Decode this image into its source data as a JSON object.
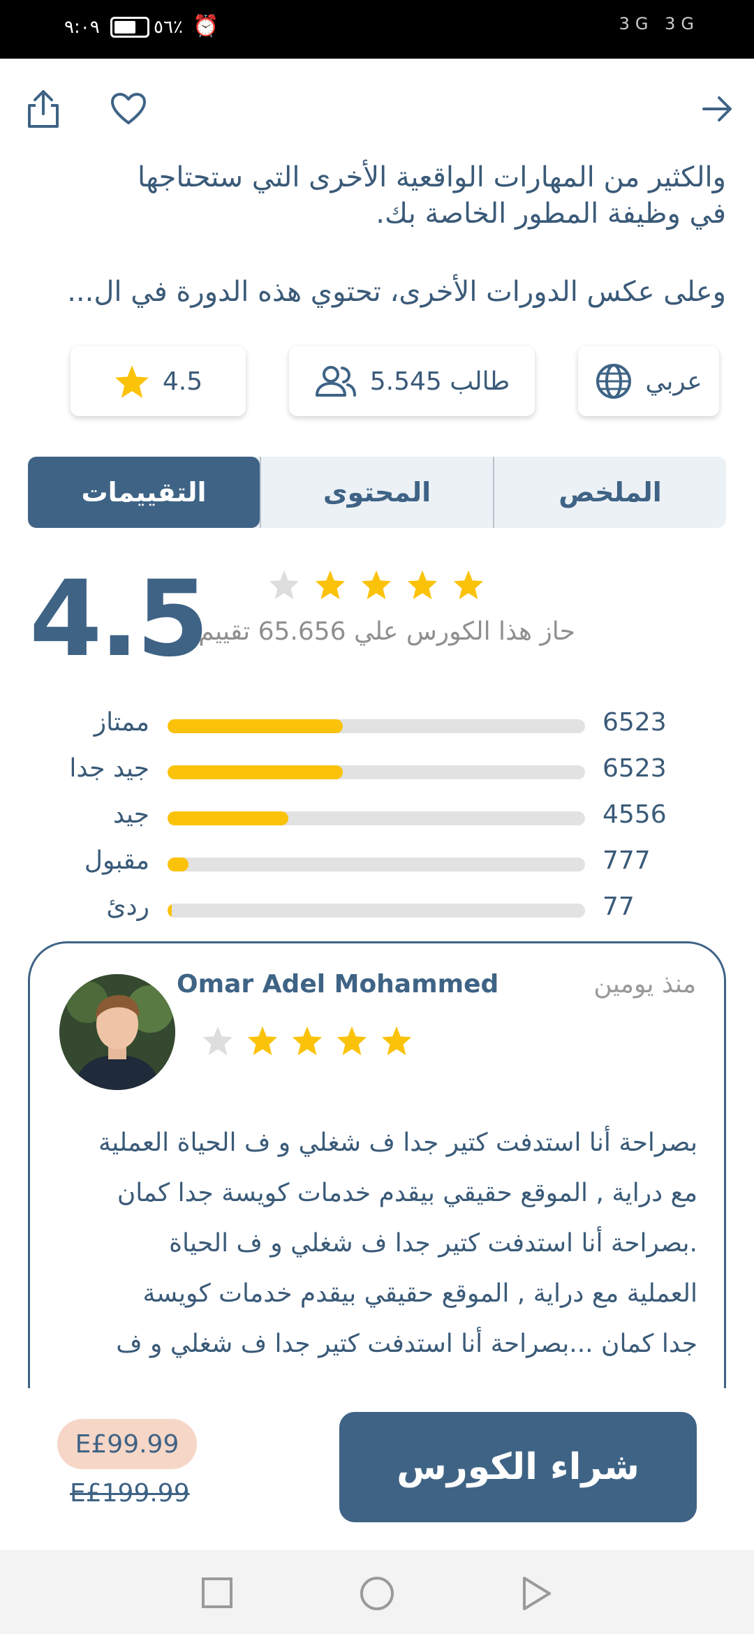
{
  "status_bar": {
    "time": "٩:٠٩",
    "battery_pct": "٥٦٪",
    "network": "3G 3G"
  },
  "course": {
    "description_lines": [
      "والكثير من المهارات الواقعية الأخرى التي ستحتاجها",
      "في وظيفة المطور الخاصة بك."
    ],
    "description_more": "وعلى عكس الدورات الأخرى، تحتوي هذه الدورة في ال..."
  },
  "chips": {
    "language": "عربي",
    "students": "5.545 طالب",
    "rating": "4.5"
  },
  "tabs": [
    {
      "label": "الملخص",
      "active": false
    },
    {
      "label": "المحتوى",
      "active": false
    },
    {
      "label": "التقييمات",
      "active": true
    }
  ],
  "ratings": {
    "average": "4.5",
    "average_value": 4.5,
    "summary": "حاز هذا الكورس علي 65.656 تقييم",
    "breakdown": [
      {
        "label": "ممتاز",
        "count": "6523",
        "fraction": 0.42
      },
      {
        "label": "جيد جدا",
        "count": "6523",
        "fraction": 0.42
      },
      {
        "label": "جيد",
        "count": "4556",
        "fraction": 0.29
      },
      {
        "label": "مقبول",
        "count": "777",
        "fraction": 0.05
      },
      {
        "label": "ردئ",
        "count": "77",
        "fraction": 0.01
      }
    ]
  },
  "review": {
    "name": "Omar Adel Mohammed",
    "time": "منذ يومين",
    "stars": 4,
    "text_lines": [
      "بصراحة أنا استدفت كتير جدا ف شغلي و ف الحياة العملية",
      "مع دراية , الموقع حقيقي بيقدم خدمات كويسة جدا كمان",
      ".بصراحة أنا استدفت كتير جدا ف شغلي و ف الحياة",
      "العملية مع دراية , الموقع حقيقي بيقدم خدمات كويسة",
      "جدا كمان ...بصراحة أنا استدفت كتير جدا ف شغلي و ف"
    ]
  },
  "purchase": {
    "price_new": "E£99.99",
    "price_old": "E£199.99",
    "buy_label": "شراء الكورس"
  },
  "colors": {
    "primary": "#3e6385",
    "star": "#fbc20a",
    "star_empty": "#dddddd",
    "price_badge": "#f6d6c7"
  }
}
